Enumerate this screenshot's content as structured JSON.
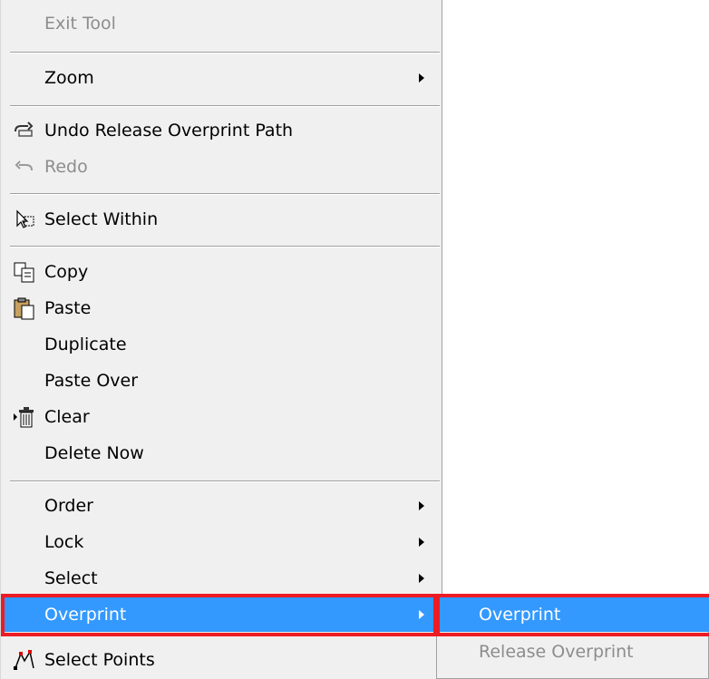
{
  "menu": {
    "exit_tool": "Exit Tool",
    "zoom": "Zoom",
    "undo": "Undo Release Overprint Path",
    "redo": "Redo",
    "select_within": "Select Within",
    "copy": "Copy",
    "paste": "Paste",
    "duplicate": "Duplicate",
    "paste_over": "Paste Over",
    "clear": "Clear",
    "delete_now": "Delete Now",
    "order": "Order",
    "lock": "Lock",
    "select": "Select",
    "overprint": "Overprint",
    "select_points": "Select Points"
  },
  "submenu": {
    "overprint": "Overprint",
    "release_overprint": "Release Overprint"
  },
  "colors": {
    "highlight": "#3399ff",
    "annotation": "#ed1c24",
    "menu_bg": "#f0f0f0"
  }
}
